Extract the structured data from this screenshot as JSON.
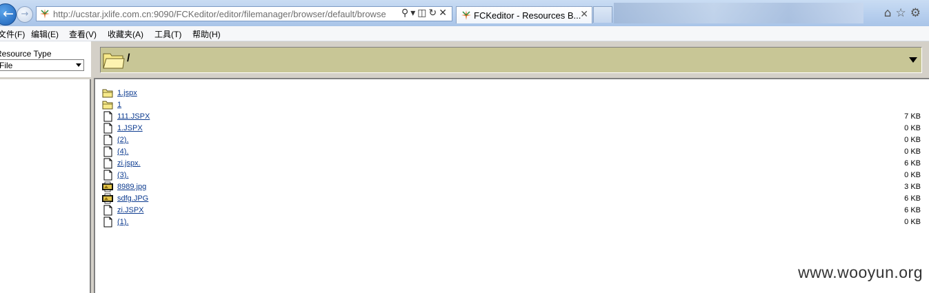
{
  "browser": {
    "address_url": "http://ucstar.jxlife.com.cn:9090/FCKeditor/editor/filemanager/browser/default/browse",
    "tab_title": "FCKeditor - Resources B...",
    "menu": [
      "文件(F)",
      "编辑(E)",
      "查看(V)",
      "收藏夹(A)",
      "工具(T)",
      "帮助(H)"
    ]
  },
  "resource_type": {
    "label": "Resource Type",
    "selected": "File"
  },
  "current_folder": "/",
  "files": [
    {
      "name": "1.jspx",
      "type": "folder",
      "size": ""
    },
    {
      "name": "1",
      "type": "folder",
      "size": ""
    },
    {
      "name": "111.JSPX",
      "type": "file",
      "size": "7 KB"
    },
    {
      "name": "1.JSPX",
      "type": "file",
      "size": "0 KB"
    },
    {
      "name": "(2).",
      "type": "file",
      "size": "0 KB"
    },
    {
      "name": "(4).",
      "type": "file",
      "size": "0 KB"
    },
    {
      "name": "zi.jspx.",
      "type": "file",
      "size": "6 KB"
    },
    {
      "name": "(3).",
      "type": "file",
      "size": "0 KB"
    },
    {
      "name": "8989.jpg",
      "type": "image",
      "size": "3 KB"
    },
    {
      "name": "sdfg.JPG",
      "type": "image",
      "size": "6 KB"
    },
    {
      "name": "zi.JSPX",
      "type": "file",
      "size": "6 KB"
    },
    {
      "name": "(1).",
      "type": "file",
      "size": "0 KB"
    }
  ],
  "watermark": "www.wooyun.org",
  "colors": {
    "folder_bar": "#c8c696",
    "link": "#0b3a8f",
    "chrome": "#b7cfee"
  },
  "icons": {
    "back": "back-arrow-icon",
    "forward": "forward-arrow-icon",
    "home": "home-icon",
    "favorites": "star-icon",
    "tools": "gear-icon"
  }
}
